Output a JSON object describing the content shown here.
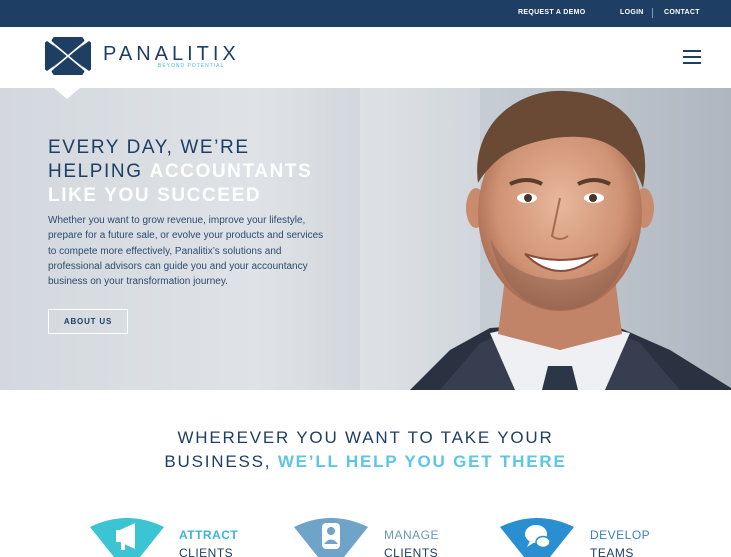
{
  "topbar": {
    "request_demo": "REQUEST A DEMO",
    "login": "LOGIN",
    "separator": "|",
    "contact": "CONTACT"
  },
  "header": {
    "brand_name": "PANALITIX",
    "tagline": "BEYOND POTENTIAL",
    "menu_icon": "hamburger-menu-icon"
  },
  "hero": {
    "title_line1": "EVERY DAY, WE’RE",
    "title_line2_plain": "HELPING ",
    "title_line2_highlight": "ACCOUNTANTS",
    "title_line3_highlight": "LIKE YOU SUCCEED",
    "body": "Whether you want to grow revenue, improve your lifestyle, prepare for a future sale, or evolve your products and services to compete more effectively, Panalitix’s solutions and professional advisors can guide you and your accountancy business on your transformation journey.",
    "button_label": "ABOUT US"
  },
  "section": {
    "title_line1": "WHEREVER YOU WANT TO TAKE YOUR",
    "title_line2_plain": "BUSINESS, ",
    "title_line2_highlight": "WE’LL HELP YOU GET THERE"
  },
  "features": [
    {
      "title": "ATTRACT",
      "subtitle": "CLIENTS",
      "icon": "megaphone-icon",
      "color": "#3bc4d1"
    },
    {
      "title": "MANAGE",
      "subtitle": "CLIENTS",
      "icon": "person-icon",
      "color": "#6fa3c8"
    },
    {
      "title": "DEVELOP",
      "subtitle": "TEAMS",
      "icon": "chat-bubbles-icon",
      "color": "#2a8fd0"
    }
  ],
  "colors": {
    "navy": "#1f3e64",
    "accent_light_blue": "#5cc6e6",
    "white": "#ffffff"
  }
}
